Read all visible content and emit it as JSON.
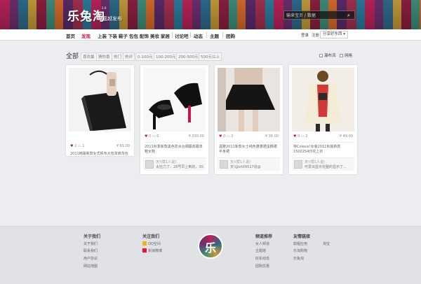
{
  "header": {
    "logo": "乐兔淘",
    "logo_badge": "2.0",
    "slogan": "嘉越发布",
    "search_placeholder": "输来宝贝 / 数据",
    "search_icon": "search-icon"
  },
  "nav": {
    "items": [
      "首页",
      "发现",
      "上装",
      "下装",
      "鞋子",
      "包包",
      "配饰",
      "美妆",
      "家居",
      "讨论吧",
      "动态",
      "主题",
      "团购"
    ],
    "active": "发现",
    "login": "登录",
    "register": "注册",
    "share": "分享好东西"
  },
  "filter": {
    "title": "全部",
    "tags": [
      "喜欢最",
      "猜你喜",
      "热门",
      "热评",
      "0-100元",
      "100-200元",
      "200-500元",
      "500元以上"
    ],
    "checkbox_1": "瀑布流",
    "checkbox_2": "网格"
  },
  "cards": [
    {
      "likes": "2",
      "comments": "1",
      "price": "¥ 65.00",
      "desc": "2011韩版新款女式帆布大包单肩背包",
      "user_name": "",
      "user_text": ""
    },
    {
      "likes": "0",
      "comments": "0",
      "price": "¥ 330.00",
      "desc": "2011秋季新款黑色防水台细跟高跟单鞋女鞋",
      "user_name": "天!(帮1人说)",
      "user_text": "太捡力了，28号早上到的，30..."
    },
    {
      "likes": "0",
      "comments": "2",
      "price": "¥ 36.00",
      "desc": "温雅2011新款女士纯色蓬蓬裙蛋糕裙半身裙",
      "user_name": "天!(帮1人说)",
      "user_text": "天!@sh09517说@"
    },
    {
      "likes": "0",
      "comments": "2",
      "price": "¥ 49.00",
      "desc": "特Colesis!女装2011秋装新款1500254印花上衣",
      "user_name": "天!(帮1人说)",
      "user_text": "可爱出显示完整的显示了..."
    }
  ],
  "footer": {
    "col1_title": "关于我们",
    "col1_links": [
      "关于我们",
      "联系我们",
      "用户协议",
      "网站地图"
    ],
    "col2_title": "关注我们",
    "col2_links": [
      "QQ空间",
      "新浪微博"
    ],
    "logo": "乐",
    "col3_title": "频道推荐",
    "col3_links": [
      "女人频道",
      "主题馆",
      "好东动态",
      "团购优惠"
    ],
    "col4_title": "友情链接",
    "col4_links": [
      "鼎程应用",
      "淘宝",
      "乐淘购物",
      "乐兔淘"
    ]
  },
  "colors": {
    "accent": "#c8164b",
    "nav_bg": "#ffffff",
    "page_bg": "#ecedf0",
    "footer_bg": "#e1e2e5"
  }
}
